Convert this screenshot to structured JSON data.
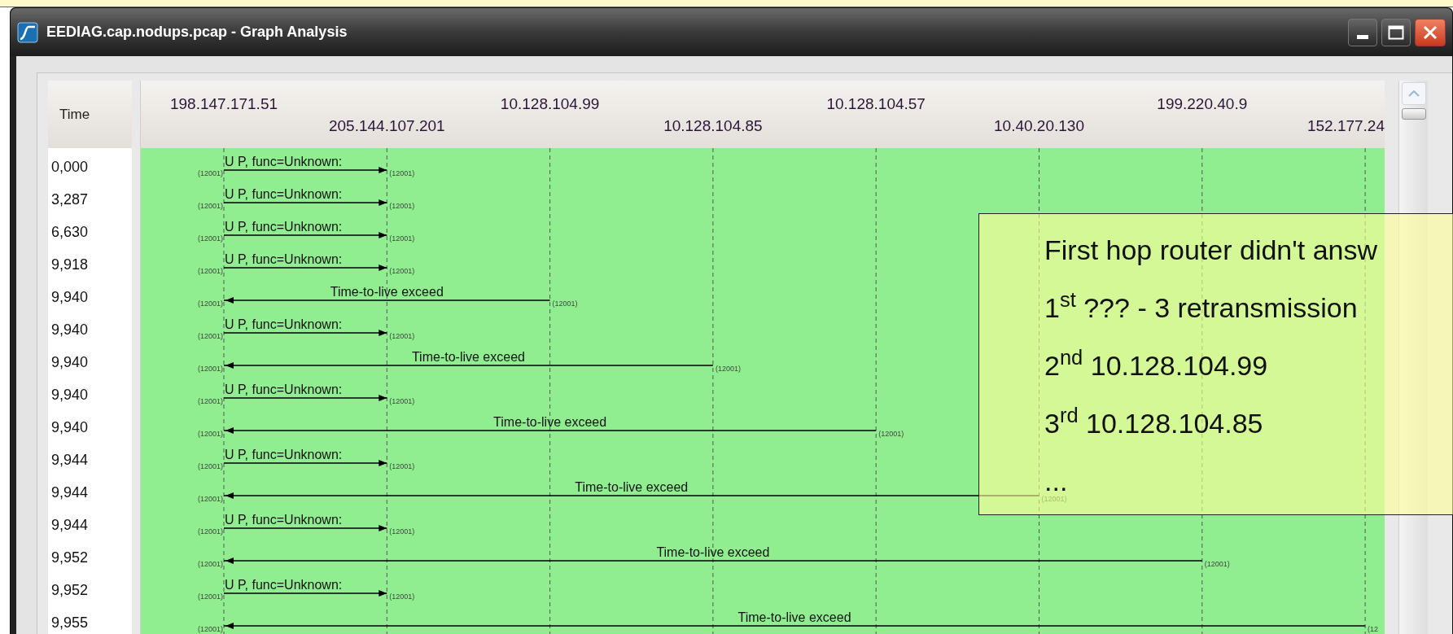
{
  "window": {
    "title": "EEDIAG.cap.nodups.pcap - Graph Analysis"
  },
  "time_column": {
    "header": "Time",
    "values": [
      "0,000",
      "3,287",
      "6,630",
      "9,918",
      "9,940",
      "9,940",
      "9,940",
      "9,940",
      "9,940",
      "9,944",
      "9,944",
      "9,944",
      "9,952",
      "9,952",
      "9,955"
    ]
  },
  "graph": {
    "hosts": [
      {
        "address": "198.147.171.51"
      },
      {
        "address": "205.144.107.201"
      },
      {
        "address": "10.128.104.99"
      },
      {
        "address": "10.128.104.85"
      },
      {
        "address": "10.128.104.57"
      },
      {
        "address": "10.40.20.130"
      },
      {
        "address": "199.220.40.9"
      },
      {
        "address": "152.177.24"
      }
    ],
    "messages": [
      {
        "kind": "request",
        "label": "U P, func=Unknown:",
        "left_port": "(12001)",
        "right_port": "(12001)"
      },
      {
        "kind": "request",
        "label": "U P, func=Unknown:",
        "left_port": "(12001)",
        "right_port": "(12001)"
      },
      {
        "kind": "request",
        "label": "U P, func=Unknown:",
        "left_port": "(12001)",
        "right_port": "(12001)"
      },
      {
        "kind": "request",
        "label": "U P, func=Unknown:",
        "left_port": "(12001)",
        "right_port": "(12001)"
      },
      {
        "kind": "reply",
        "label": "Time-to-live exceed",
        "left_port": "(12001)",
        "right_port": "(12001)"
      },
      {
        "kind": "request",
        "label": "U P, func=Unknown:",
        "left_port": "(12001)",
        "right_port": "(12001)"
      },
      {
        "kind": "reply",
        "label": "Time-to-live exceed",
        "left_port": "(12001)",
        "right_port": "(12001)"
      },
      {
        "kind": "request",
        "label": "U P, func=Unknown:",
        "left_port": "(12001)",
        "right_port": "(12001)"
      },
      {
        "kind": "reply",
        "label": "Time-to-live exceed",
        "left_port": "(12001)",
        "right_port": "(12001)"
      },
      {
        "kind": "request",
        "label": "U P, func=Unknown:",
        "left_port": "(12001)",
        "right_port": "(12001)"
      },
      {
        "kind": "reply",
        "label": "Time-to-live exceed",
        "left_port": "(12001)",
        "right_port": "(12001)"
      },
      {
        "kind": "request",
        "label": "U P, func=Unknown:",
        "left_port": "(12001)",
        "right_port": "(12001)"
      },
      {
        "kind": "reply",
        "label": "Time-to-live exceed",
        "left_port": "(12001)",
        "right_port": "(12001)"
      },
      {
        "kind": "request",
        "label": "U P, func=Unknown:",
        "left_port": "(12001)",
        "right_port": "(12001)"
      },
      {
        "kind": "reply",
        "label": "Time-to-live exceed",
        "left_port": "(12001)",
        "right_port": "(12"
      }
    ]
  },
  "callout": {
    "lines": [
      "First hop router didn't answ",
      "1$^{st}$  ???  - 3 retransmission",
      "2$^{nd}$ 10.128.104.99",
      "3$^{rd}$  10.128.104.85",
      "..."
    ]
  }
}
